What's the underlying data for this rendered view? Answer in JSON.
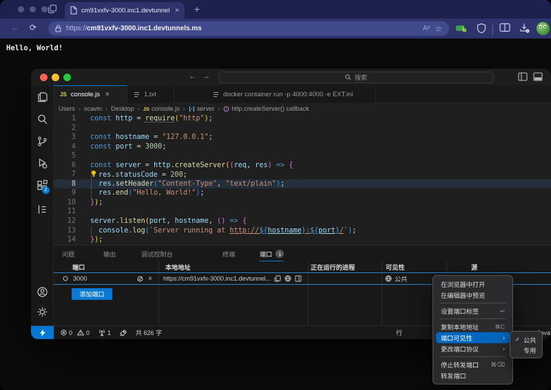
{
  "browser": {
    "tab_title": "cm91vxfv-3000.inc1.devtunnel",
    "tab_close": "×",
    "new_tab": "+",
    "url_scheme": "https://",
    "url_host": "cm91vxfv-3000.inc1.devtunnels.ms",
    "read_aloud": "Aᵃ",
    "favorite_star": "☆",
    "page_text": "Hello, World!"
  },
  "vscode": {
    "search_placeholder": "搜索",
    "nav_back": "←",
    "nav_forward": "→",
    "tabs": [
      {
        "label": "console.js",
        "close": "×"
      },
      {
        "label": "1.txt"
      },
      {
        "label": "docker container run -p 4000:4000 -e EXT.ini"
      }
    ],
    "breadcrumb": [
      "Users",
      "scavin",
      "Desktop",
      "console.js",
      "server",
      "http.createServer() callback"
    ],
    "code": {
      "lines": [
        {
          "tokens": [
            [
              "kw",
              "const"
            ],
            [
              "pun",
              " "
            ],
            [
              "var",
              "http"
            ],
            [
              "pun",
              " = "
            ],
            [
              "req",
              "require"
            ],
            [
              "b1",
              "("
            ],
            [
              "str",
              "\"http\""
            ],
            [
              "b1",
              ")"
            ],
            [
              "pun",
              ";"
            ]
          ]
        },
        {
          "tokens": []
        },
        {
          "tokens": [
            [
              "kw",
              "const"
            ],
            [
              "pun",
              " "
            ],
            [
              "var",
              "hostname"
            ],
            [
              "pun",
              " = "
            ],
            [
              "str",
              "\"127.0.0.1\""
            ],
            [
              "pun",
              ";"
            ]
          ]
        },
        {
          "tokens": [
            [
              "kw",
              "const"
            ],
            [
              "pun",
              " "
            ],
            [
              "var",
              "port"
            ],
            [
              "pun",
              " = "
            ],
            [
              "num",
              "3000"
            ],
            [
              "pun",
              ";"
            ]
          ]
        },
        {
          "tokens": []
        },
        {
          "tokens": [
            [
              "kw",
              "const"
            ],
            [
              "pun",
              " "
            ],
            [
              "var",
              "server"
            ],
            [
              "pun",
              " = "
            ],
            [
              "var",
              "http"
            ],
            [
              "pun",
              "."
            ],
            [
              "fn",
              "createServer"
            ],
            [
              "b1",
              "("
            ],
            [
              "b2",
              "("
            ],
            [
              "var",
              "req"
            ],
            [
              "pun",
              ", "
            ],
            [
              "var",
              "res"
            ],
            [
              "b2",
              ")"
            ],
            [
              "pun",
              " "
            ],
            [
              "kw",
              "=>"
            ],
            [
              "pun",
              " "
            ],
            [
              "b2",
              "{"
            ]
          ]
        },
        {
          "ind": true,
          "tokens": [
            [
              "bulb",
              ""
            ],
            [
              "var",
              "res"
            ],
            [
              "pun",
              "."
            ],
            [
              "var",
              "statusCode"
            ],
            [
              "pun",
              " = "
            ],
            [
              "num",
              "200"
            ],
            [
              "pun",
              ";"
            ]
          ]
        },
        {
          "ind": true,
          "cur": true,
          "tokens": [
            [
              "pun",
              "  "
            ],
            [
              "var",
              "res"
            ],
            [
              "pun",
              "."
            ],
            [
              "fn",
              "setHeader"
            ],
            [
              "b3",
              "("
            ],
            [
              "str",
              "\"Content-Type\""
            ],
            [
              "pun",
              ", "
            ],
            [
              "str",
              "\"text/plain\""
            ],
            [
              "b3",
              ")"
            ],
            [
              "pun",
              ";"
            ]
          ]
        },
        {
          "ind": true,
          "tokens": [
            [
              "pun",
              "  "
            ],
            [
              "var",
              "res"
            ],
            [
              "pun",
              "."
            ],
            [
              "fn",
              "end"
            ],
            [
              "b3",
              "("
            ],
            [
              "str",
              "\"Hello, World!\""
            ],
            [
              "b3",
              ")"
            ],
            [
              "pun",
              ";"
            ]
          ]
        },
        {
          "tokens": [
            [
              "b2",
              "}"
            ],
            [
              "b1",
              ")"
            ],
            [
              "pun",
              ";"
            ]
          ]
        },
        {
          "tokens": []
        },
        {
          "tokens": [
            [
              "var",
              "server"
            ],
            [
              "pun",
              "."
            ],
            [
              "fn",
              "listen"
            ],
            [
              "b1",
              "("
            ],
            [
              "var",
              "port"
            ],
            [
              "pun",
              ", "
            ],
            [
              "var",
              "hostname"
            ],
            [
              "pun",
              ", "
            ],
            [
              "b2",
              "()"
            ],
            [
              "pun",
              " "
            ],
            [
              "kw",
              "=>"
            ],
            [
              "pun",
              " "
            ],
            [
              "b2",
              "{"
            ]
          ]
        },
        {
          "ind": true,
          "tokens": [
            [
              "pun",
              "  "
            ],
            [
              "var",
              "console"
            ],
            [
              "pun",
              "."
            ],
            [
              "fn",
              "log"
            ],
            [
              "b3",
              "("
            ],
            [
              "str",
              "`Server running at "
            ],
            [
              "strl",
              "http://"
            ],
            [
              "kwl",
              "${"
            ],
            [
              "varl",
              "hostname"
            ],
            [
              "kwl",
              "}"
            ],
            [
              "strl",
              ":"
            ],
            [
              "kwl",
              "${"
            ],
            [
              "varl",
              "port"
            ],
            [
              "kwl",
              "}"
            ],
            [
              "strl",
              "/"
            ],
            [
              "str",
              "`"
            ],
            [
              "b3",
              ")"
            ],
            [
              "pun",
              ";"
            ]
          ]
        },
        {
          "tokens": [
            [
              "b2",
              "}"
            ],
            [
              "b1",
              ")"
            ],
            [
              "pun",
              ";"
            ]
          ]
        }
      ]
    },
    "panel": {
      "tabs": [
        "问题",
        "输出",
        "调试控制台",
        "终端",
        "端口"
      ],
      "active_tab": "端口",
      "badge": "1",
      "table": {
        "headers": [
          "端口",
          "本地地址",
          "正在运行的进程",
          "可见性",
          "源"
        ],
        "row": {
          "port": "3000",
          "address": "https://cm91vxfv-3000.inc1.devtunnel...",
          "visibility": "公共"
        }
      },
      "add_button": "添加端口"
    },
    "status": {
      "errors": "0",
      "warnings": "0",
      "ports": "1",
      "word_count": "共 626 字",
      "line_label": "行",
      "language": "JavaScript"
    }
  },
  "menu": {
    "items": [
      {
        "label": "在浏览器中打开"
      },
      {
        "label": "在编辑器中预览",
        "sep": true
      },
      {
        "label": "设置端口标签",
        "shortcut": "↩",
        "sep": true
      },
      {
        "label": "复制本地地址",
        "shortcut": "⌘C"
      },
      {
        "label": "端口可见性",
        "submenu": true,
        "active": true
      },
      {
        "label": "更改端口协议",
        "submenu": true,
        "sep": true
      },
      {
        "label": "停止转发端口",
        "shortcut": "⌘⌫"
      },
      {
        "label": "转发端口"
      }
    ]
  },
  "submenu": {
    "items": [
      {
        "label": "公共",
        "checked": true
      },
      {
        "label": "专用",
        "checked": false
      }
    ]
  },
  "colors": {
    "accent_blue": "#0078d4",
    "menu_highlight": "#0067c0",
    "row_focus": "#2b7fd4",
    "edge_chrome": "#2e346b",
    "edge_strip": "#1c214d"
  }
}
